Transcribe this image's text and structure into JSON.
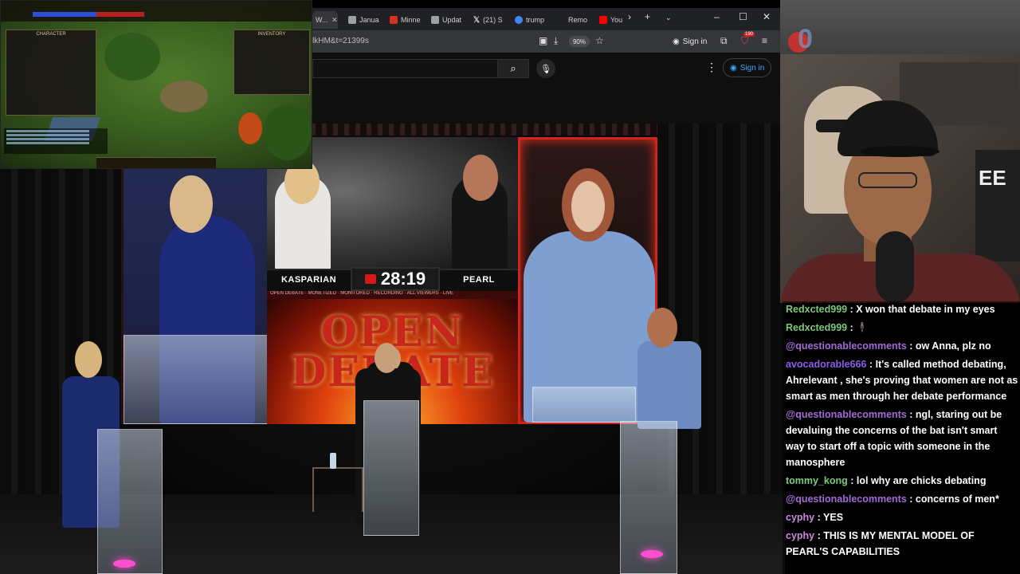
{
  "browser": {
    "tabs": [
      {
        "label": "W...",
        "favicon_color": "#8a8a8a",
        "active": true
      },
      {
        "label": "Janua",
        "favicon_color": "#9aa0a6",
        "active": false
      },
      {
        "label": "Minne",
        "favicon_color": "#d93025",
        "active": false
      },
      {
        "label": "Updat",
        "favicon_color": "#9aa0a6",
        "active": false
      },
      {
        "label": "(21) S",
        "favicon_color": "#ffffff",
        "active": false
      },
      {
        "label": "trump",
        "favicon_color": "#4285f4",
        "active": false
      },
      {
        "label": "Remo",
        "favicon_color": "#5f6368",
        "active": false
      },
      {
        "label": "You",
        "favicon_color": "#ff0000",
        "active": false
      }
    ],
    "url_fragment": "lkHM&t=21399s",
    "zoom": "90%",
    "toolbar_signin": "Sign in",
    "extension_badge": "190",
    "page_signin": "Sign in"
  },
  "game": {
    "character_panel_title": "CHARACTER",
    "inventory_panel_title": "INVENTORY"
  },
  "stream_counter": "0",
  "stage": {
    "name_left": "KASPARIAN",
    "timer": "28:19",
    "name_right": "PEARL",
    "ticker": "OPEN DEBATE · MONETIZED · MONITORED · RECORDING · ALL VIEWERS · LIVE",
    "banner": "OPEN DEBATE",
    "accent_color": "#d1241a"
  },
  "webcam": {
    "poster_text": "EE"
  },
  "chat": {
    "messages": [
      {
        "user": "Redxcted999",
        "user_color": "#7ec87a",
        "text": "X won that debate in my eyes"
      },
      {
        "user": "Redxcted999",
        "user_color": "#7ec87a",
        "text": "🕴"
      },
      {
        "user": "@questionablecomments",
        "user_color": "#a46bd6",
        "text": "ow Anna, plz no"
      },
      {
        "user": "avocadorable666",
        "user_color": "#8f5ce8",
        "text": "It's called method debating, Ahrelevant , she's proving that women are not as smart as men through her debate performance"
      },
      {
        "user": "@questionablecomments",
        "user_color": "#a46bd6",
        "text": "ngl, staring out be devaluing the concerns of the bat isn't smart way to start off a topic with someone in the manosphere"
      },
      {
        "user": "tommy_kong",
        "user_color": "#7ec87a",
        "text": "lol why are chicks debating"
      },
      {
        "user": "@questionablecomments",
        "user_color": "#a46bd6",
        "text": "concerns of men*"
      },
      {
        "user": "cyphy",
        "user_color": "#c98ad8",
        "text": "YES"
      },
      {
        "user": "cyphy",
        "user_color": "#c98ad8",
        "text": "THIS IS MY MENTAL MODEL OF PEARL'S CAPABILITIES"
      }
    ]
  }
}
